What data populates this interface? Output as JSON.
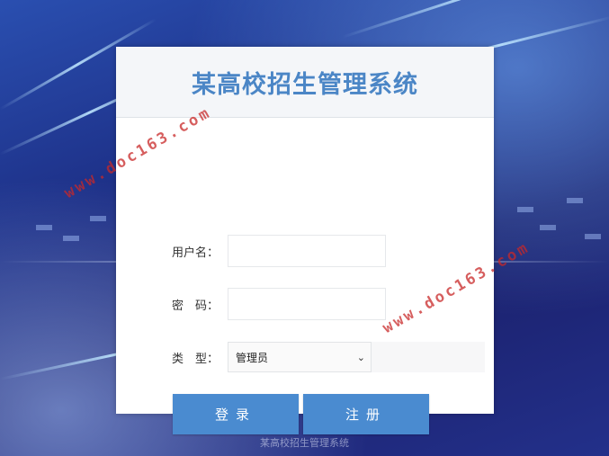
{
  "header": {
    "title": "某高校招生管理系统"
  },
  "form": {
    "username_label": "用户名：",
    "username_value": "",
    "password_label": "密　码：",
    "password_value": "",
    "type_label": "类　型：",
    "type_selected": "管理员"
  },
  "buttons": {
    "login": "登录",
    "register": "注册"
  },
  "footer": {
    "text": "某高校招生管理系统"
  },
  "watermarks": [
    "www.doc163.com",
    "www.doc163.com"
  ],
  "colors": {
    "title": "#4b86c6",
    "button": "#4a8bd0",
    "watermark": "#c82828"
  }
}
